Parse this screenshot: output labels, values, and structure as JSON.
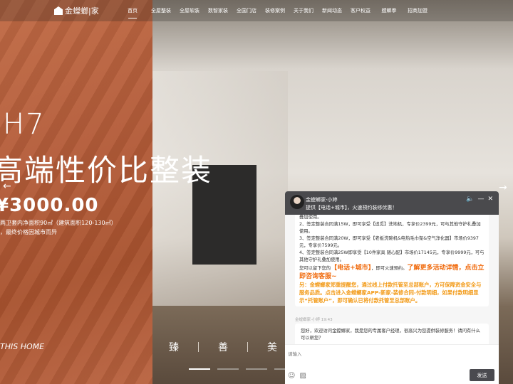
{
  "brand": {
    "name": "金螳螂|家"
  },
  "nav": {
    "items": [
      "首页",
      "全屋整装",
      "全屋软装",
      "数智家装",
      "全国门店",
      "装修案例",
      "关于我们",
      "新闻动态",
      "客户权益",
      "螳螂拳",
      "招商加盟"
    ],
    "active": 0
  },
  "hero": {
    "model": "H7",
    "slogan": "高端性价比整装",
    "price": "¥3000.00",
    "desc_line1": "两卫套内净面积90㎡（建筑面积120-130㎡）",
    "desc_line2": "，最终价格因城市而异",
    "home_text": "THIS HOME",
    "values": [
      "臻",
      "善",
      "美"
    ],
    "slide_index": 1,
    "slide_count": 4
  },
  "chat": {
    "agent_name": "金螳螂家-小婷",
    "subtitle": "提供【电话+城市】，火速预约装修优惠！",
    "msg1_lines": [
      "叠加使用。",
      "2、签定整装合同满15W，即可享受【追觅】洗地机，专享价2399元，可与其他守护礼叠加使用。",
      "3、签定整装合同满20W，即可享受【老板洗碗机&电热毛巾架&空气净化器】市场价9397元，专享价7599元。",
      "4、签定整装合同满25W即享受【10件家具 随心配】市场价17145元，专享价9999元，可与其他守护礼叠加使用。"
    ],
    "msg1_prefix": "您可以留下您的",
    "msg1_highlight": "【电话+城市】",
    "msg1_mid": "，即可火速预约。",
    "msg1_cta": "了解更多活动详情，点击立即咨询客服~",
    "msg1_note": "另：金螳螂家郑重提醒您，通过线上付款托管至总部账户，方可保障资金安全与服务品质。点击进入金螳螂家APP-新家-装修合同-付款明细，如果付款明细显示“托管账户”，即可确认已将付款托管至总部账户。",
    "msg2_meta": "金螳螂家-小婷 19:43",
    "msg2": "您好，欢迎访问金螳螂家，我是您的专属客户经理，很高兴为您提供装修服务！请问有什么可以帮您？",
    "input_placeholder": "请输入",
    "send_label": "发送"
  },
  "colors": {
    "accent_orange": "#f06a0c",
    "chat_header": "#4a4a4d",
    "terracotta": "#b45c39"
  }
}
